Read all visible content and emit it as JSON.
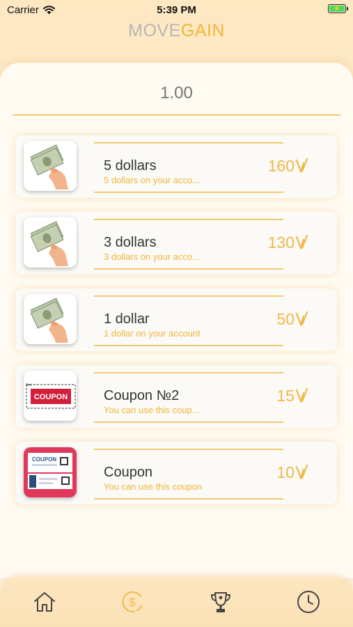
{
  "status_bar": {
    "carrier": "Carrier",
    "time": "5:39 PM"
  },
  "app": {
    "logo_part1": "MOVE",
    "logo_part2": "GAIN"
  },
  "balance": {
    "value": "1.00"
  },
  "colors": {
    "accent": "#f3b53a",
    "line": "#f3c970",
    "bg": "#fdf0dc"
  },
  "rewards": [
    {
      "title": "5 dollars",
      "description": "5 dollars on your acco...",
      "price": "160",
      "image": "money-hand-image"
    },
    {
      "title": "3 dollars",
      "description": "3 dollars on your acco...",
      "price": "130",
      "image": "money-hand-image"
    },
    {
      "title": "1 dollar",
      "description": "1 dollar on your account",
      "price": "50",
      "image": "money-hand-image"
    },
    {
      "title": "Coupon №2",
      "description": "You can use this coup...",
      "price": "15",
      "image": "coupon-image",
      "image_text": "COUPON"
    },
    {
      "title": "Coupon",
      "description": "You can use this coupon",
      "price": "10",
      "image": "coupon-ticket-image",
      "image_text": "COUPON"
    }
  ],
  "bottom_nav": {
    "items": [
      {
        "name": "home",
        "icon": "home-icon"
      },
      {
        "name": "rewards",
        "icon": "dollar-coin-icon",
        "active": true
      },
      {
        "name": "leaderboard",
        "icon": "trophy-icon"
      },
      {
        "name": "history",
        "icon": "clock-icon"
      }
    ]
  }
}
